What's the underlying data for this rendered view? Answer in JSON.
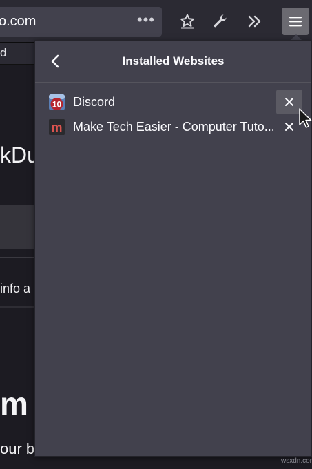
{
  "toolbar": {
    "url_fragment": "o.com",
    "more_label": "•••",
    "buttons": [
      {
        "icon": "bookmark-star-icon"
      },
      {
        "icon": "wrench-icon"
      },
      {
        "icon": "overflow-chevrons-icon"
      },
      {
        "icon": "hamburger-menu-icon",
        "active": true
      }
    ]
  },
  "page": {
    "tab_fragment": "d",
    "frag_1": "kDu",
    "frag_2": "info a",
    "frag_3": "m",
    "frag_4": "our b"
  },
  "panel": {
    "title": "Installed Websites",
    "back_icon": "chevron-left-icon",
    "items": [
      {
        "label": "Discord",
        "icon": "discord-site-icon",
        "icon_text": "10",
        "close_hovered": true
      },
      {
        "label": "Make Tech Easier - Computer Tuto...",
        "icon": "mte-site-icon",
        "icon_text": "m"
      }
    ]
  },
  "watermark": "wsxdn.com",
  "colors": {
    "toolbar_bg": "#2b2a33",
    "panel_bg": "#42414d",
    "text": "#fbfbfe",
    "discord_red": "#b6262d",
    "mte_red": "#c0392b"
  }
}
